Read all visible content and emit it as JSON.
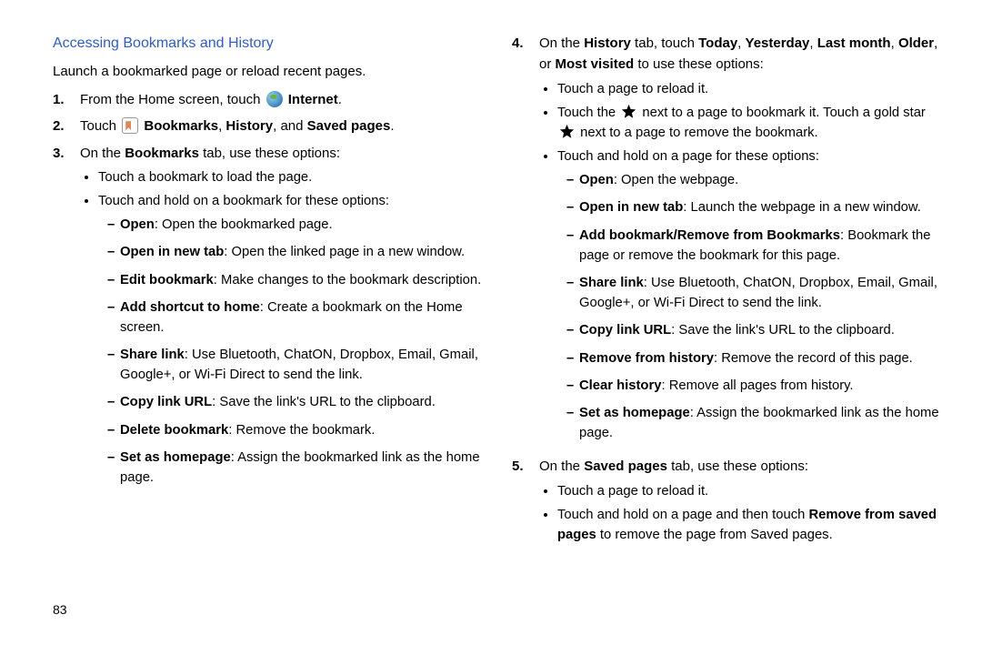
{
  "page_number": "83",
  "left": {
    "heading": "Accessing Bookmarks and History",
    "intro": "Launch a bookmarked page or reload recent pages.",
    "step1": {
      "num": "1.",
      "a": "From the Home screen, touch ",
      "b": "Internet",
      "c": "."
    },
    "step2": {
      "num": "2.",
      "a": "Touch ",
      "b1": "Bookmarks",
      "s1": ", ",
      "b2": "History",
      "s2": ", and ",
      "b3": "Saved pages",
      "c": "."
    },
    "step3": {
      "num": "3.",
      "a": "On the ",
      "b": "Bookmarks",
      "c": " tab, use these options:",
      "bul1": "Touch a bookmark to load the page.",
      "bul2": "Touch and hold on a bookmark for these options:",
      "d1": {
        "b": "Open",
        "t": ": Open the bookmarked page."
      },
      "d2": {
        "b": "Open in new tab",
        "t": ": Open the linked page in a new window."
      },
      "d3": {
        "b": "Edit bookmark",
        "t": ": Make changes to the bookmark description."
      },
      "d4": {
        "b": "Add shortcut to home",
        "t": ": Create a bookmark on the Home screen."
      },
      "d5": {
        "b": "Share link",
        "t": ": Use Bluetooth, ChatON, Dropbox, Email, Gmail, Google+, or Wi-Fi Direct to send the link."
      },
      "d6": {
        "b": "Copy link URL",
        "t": ": Save the link's URL to the clipboard."
      },
      "d7": {
        "b": "Delete bookmark",
        "t": ": Remove the bookmark."
      },
      "d8": {
        "b": "Set as homepage",
        "t": ": Assign the bookmarked link as the home page."
      }
    }
  },
  "right": {
    "step4": {
      "num": "4.",
      "a": "On the ",
      "b1": "History",
      "s1": " tab, touch ",
      "b2": "Today",
      "s2": ", ",
      "b3": "Yesterday",
      "s3": ", ",
      "b4": "Last month",
      "s4": ", ",
      "b5": "Older",
      "s5": ", or ",
      "b6": "Most visited",
      "s6": " to use these options:",
      "bul1": "Touch a page to reload it.",
      "bul2": {
        "p1": "Touch the ",
        "p2": " next to a page to bookmark it. Touch a gold star ",
        "p3": " next to a page to remove the bookmark."
      },
      "bul3": "Touch and hold on a page for these options:",
      "d1": {
        "b": "Open",
        "t": ": Open the webpage."
      },
      "d2": {
        "b": "Open in new tab",
        "t": ": Launch the webpage in a new window."
      },
      "d3": {
        "b": "Add bookmark/Remove from Bookmarks",
        "t": ": Bookmark the page or remove the bookmark for this page."
      },
      "d4": {
        "b": "Share link",
        "t": ": Use Bluetooth, ChatON, Dropbox, Email, Gmail, Google+, or Wi-Fi Direct to send the link."
      },
      "d5": {
        "b": "Copy link URL",
        "t": ": Save the link's URL to the clipboard."
      },
      "d6": {
        "b": "Remove from history",
        "t": ": Remove the record of this page."
      },
      "d7": {
        "b": "Clear history",
        "t": ": Remove all pages from history."
      },
      "d8": {
        "b": "Set as homepage",
        "t": ": Assign the bookmarked link as the home page."
      }
    },
    "step5": {
      "num": "5.",
      "a": "On the ",
      "b": "Saved pages",
      "c": " tab, use these options:",
      "bul1": "Touch a page to reload it.",
      "bul2": {
        "p1": "Touch and hold on a page and then touch ",
        "b": "Remove from saved pages",
        "p2": " to remove the page from Saved pages."
      }
    }
  }
}
